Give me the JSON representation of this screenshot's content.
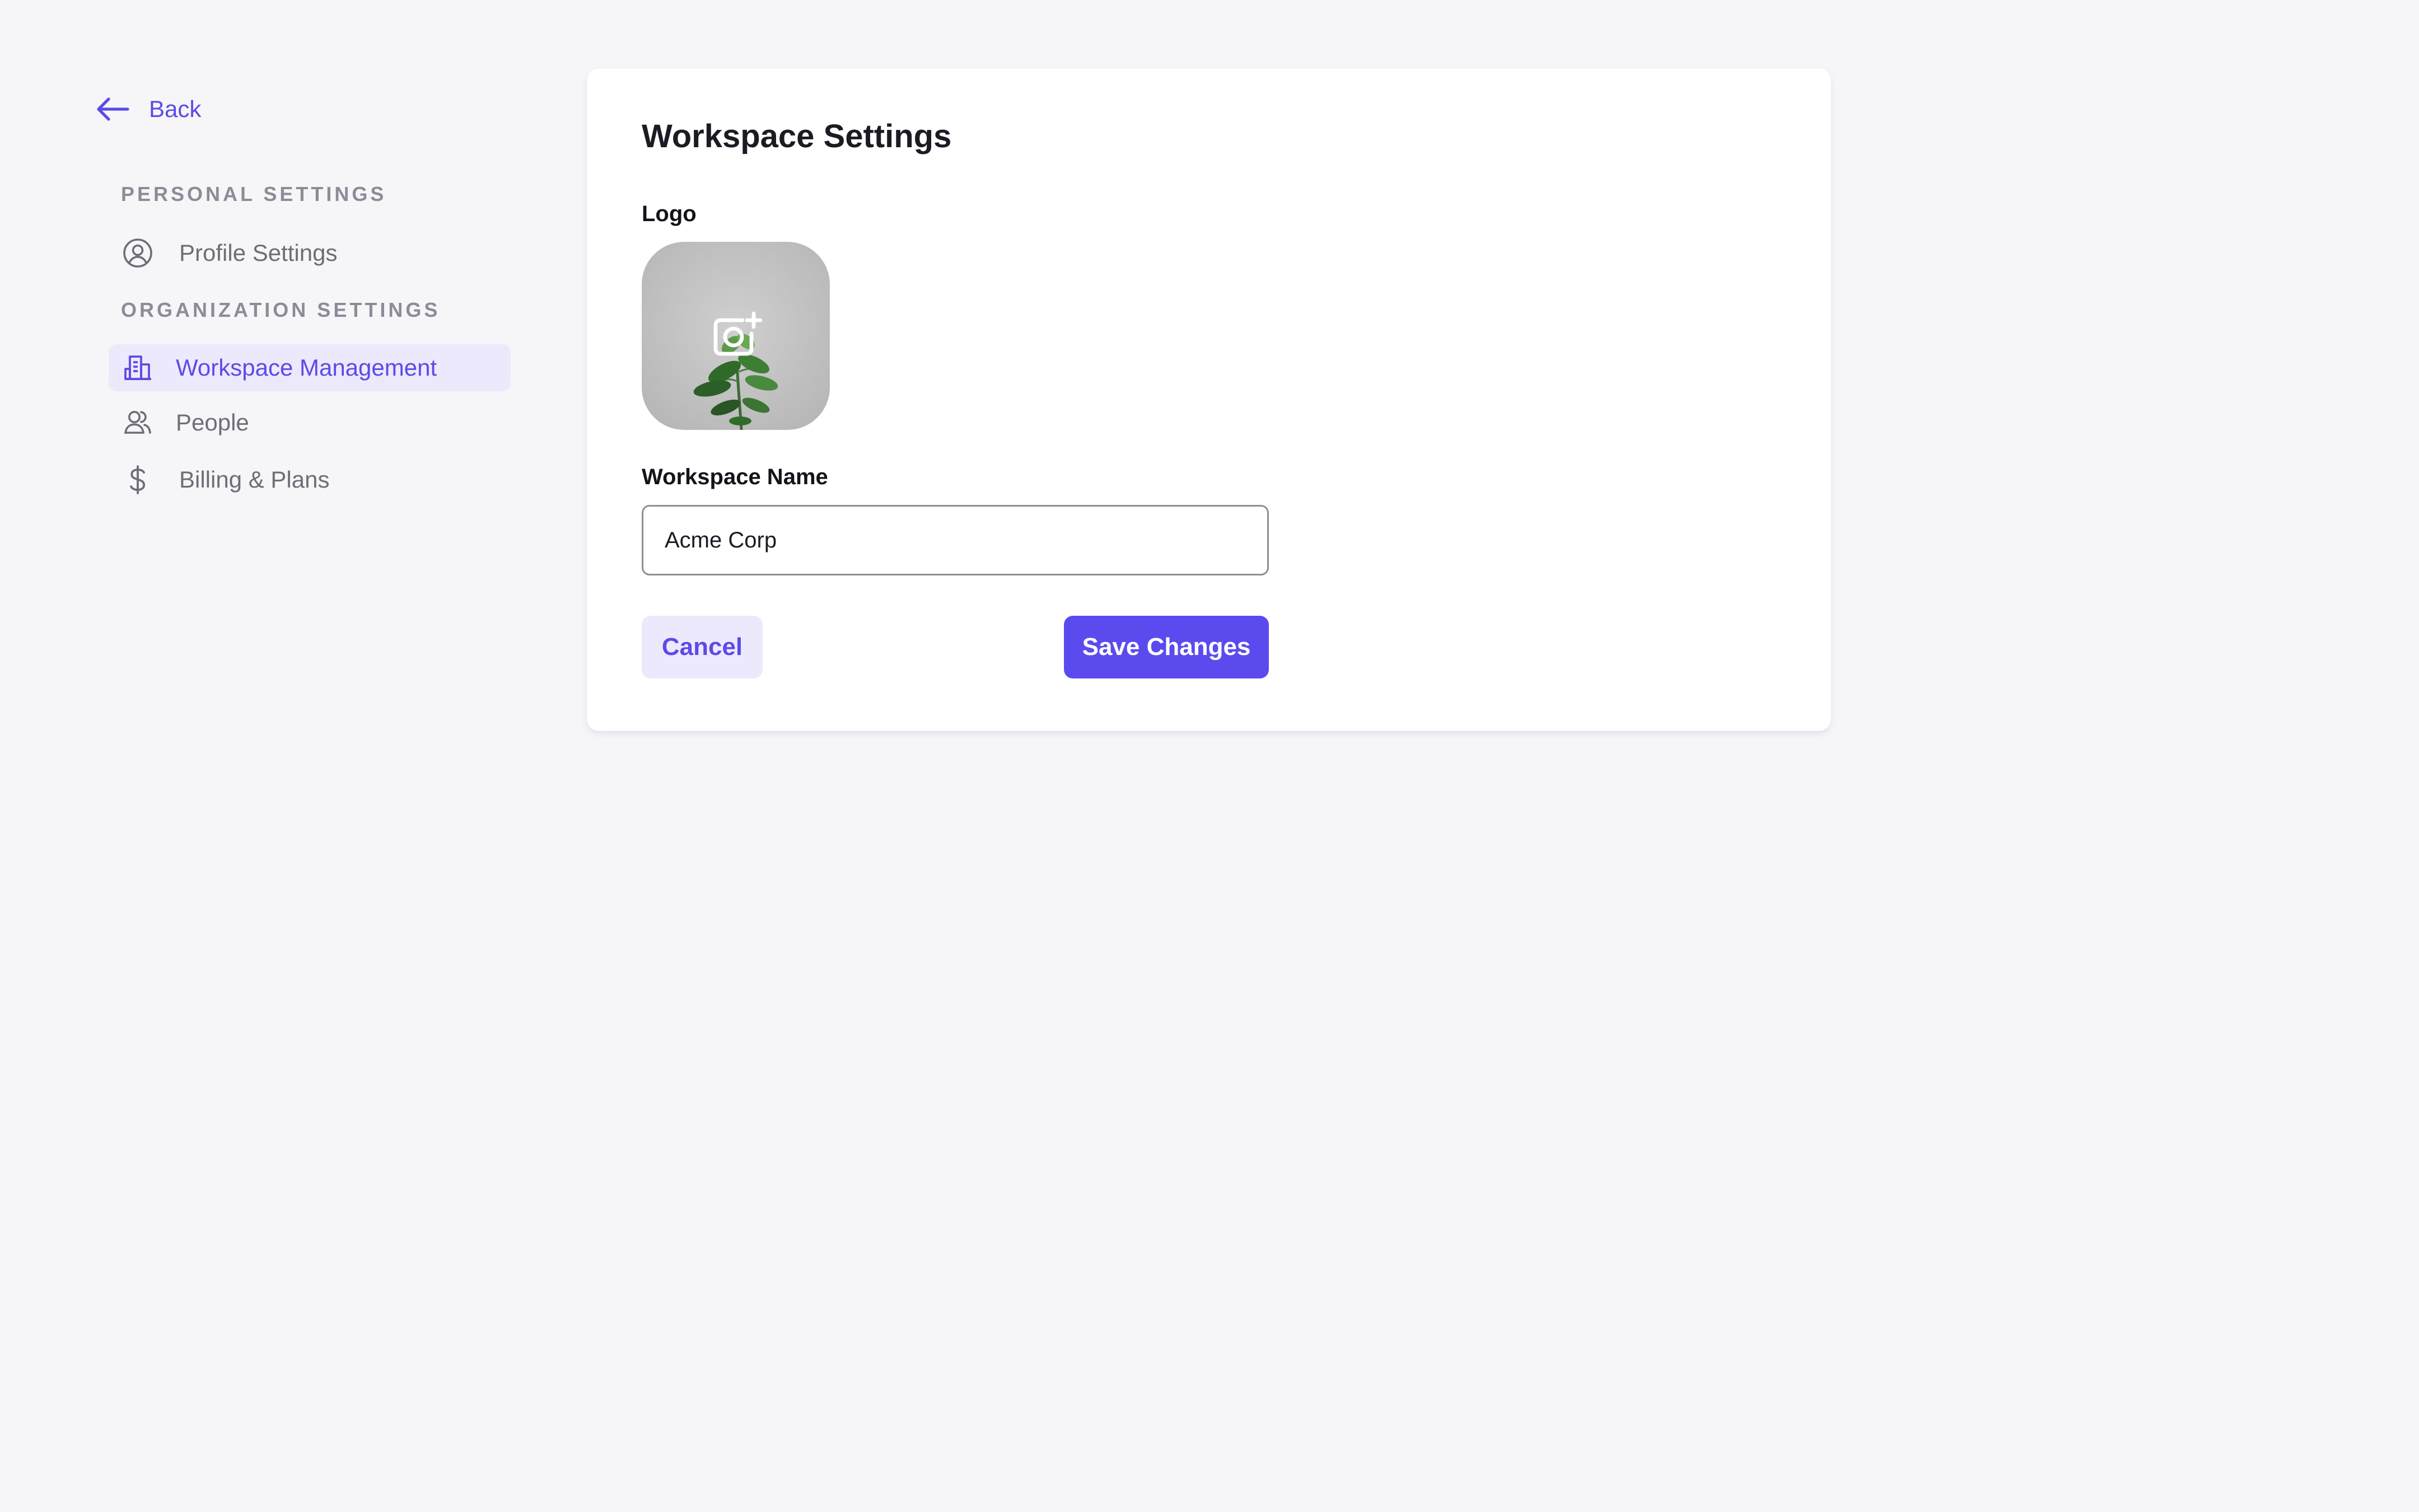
{
  "sidebar": {
    "back_label": "Back",
    "personal_heading": "PERSONAL SETTINGS",
    "organization_heading": "ORGANIZATION SETTINGS",
    "items": [
      {
        "label": "Profile Settings",
        "icon": "user-circle-icon",
        "active": false
      },
      {
        "label": "Workspace Management",
        "icon": "building-icon",
        "active": true
      },
      {
        "label": "People",
        "icon": "users-icon",
        "active": false
      },
      {
        "label": "Billing & Plans",
        "icon": "dollar-icon",
        "active": false
      }
    ]
  },
  "main": {
    "title": "Workspace Settings",
    "logo_label": "Logo",
    "logo_overlay_icon": "camera-plus-icon",
    "name_label": "Workspace Name",
    "name_value": "Acme Corp",
    "cancel_label": "Cancel",
    "save_label": "Save Changes"
  },
  "colors": {
    "accent": "#5b4bef",
    "accent_soft": "#ede9fc",
    "background": "#f6f6f8",
    "muted_text": "#8c8c98"
  }
}
